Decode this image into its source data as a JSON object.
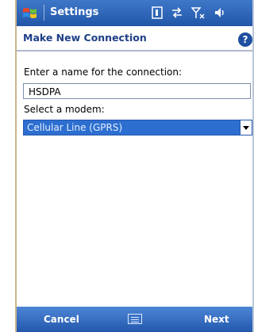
{
  "titlebar": {
    "title": "Settings"
  },
  "header": {
    "title": "Make New Connection",
    "help_symbol": "?"
  },
  "form": {
    "name_label": "Enter a name for the connection:",
    "name_value": "HSDPA",
    "modem_label": "Select a modem:",
    "modem_value": "Cellular Line (GPRS)"
  },
  "menubar": {
    "left": "Cancel",
    "right": "Next"
  },
  "icons": {
    "start": "windows-flag-icon",
    "sim": "sim-icon",
    "connectivity": "connectivity-arrows-icon",
    "signal": "signal-strength-icon",
    "speaker": "speaker-icon",
    "help": "help-icon",
    "keyboard": "keyboard-icon"
  },
  "colors": {
    "titlebar": "#2d64b8",
    "header_text": "#1f3f86",
    "selection": "#2d6fd0"
  }
}
